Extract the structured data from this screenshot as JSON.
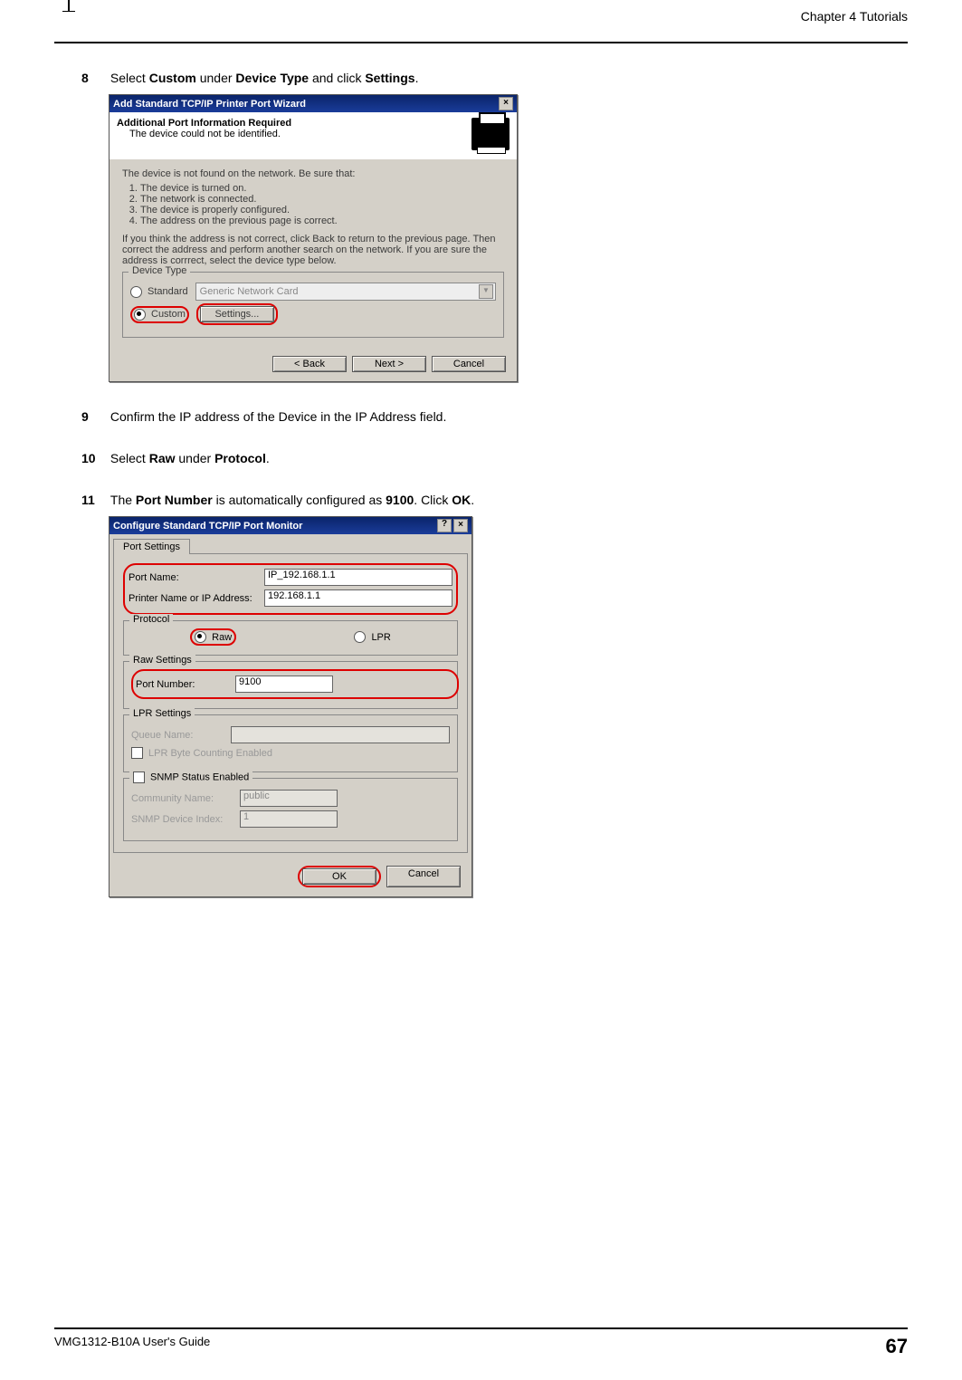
{
  "header": {
    "chapter": "Chapter 4 Tutorials"
  },
  "steps": {
    "s8": {
      "num": "8",
      "t1": "Select ",
      "b1": "Custom",
      "t2": " under ",
      "b2": "Device Type",
      "t3": " and click ",
      "b3": "Settings",
      "t4": "."
    },
    "s9": {
      "num": "9",
      "text": "Confirm the IP address of the Device in the IP Address field."
    },
    "s10": {
      "num": "10",
      "t1": "Select ",
      "b1": "Raw",
      "t2": " under ",
      "b2": "Protocol",
      "t3": "."
    },
    "s11": {
      "num": "11",
      "t1": "The ",
      "b1": "Port Number",
      "t2": " is automatically configured as ",
      "b2": "9100",
      "t3": ". Click ",
      "b3": "OK",
      "t4": "."
    }
  },
  "dlg1": {
    "title": "Add Standard TCP/IP Printer Port Wizard",
    "close": "×",
    "banner_title": "Additional Port Information Required",
    "banner_sub": "The device could not be identified.",
    "body_intro": "The device is not found on the network.  Be sure that:",
    "li1": "The device is turned on.",
    "li2": "The network is connected.",
    "li3": "The device is properly configured.",
    "li4": "The address on the previous page is correct.",
    "body_para": "If you think the address is not correct, click Back to return to the previous page.  Then correct the address and perform another search on the network.  If you are sure the address is corrrect, select the device type below.",
    "legend": "Device Type",
    "radio_standard": "Standard",
    "combo_value": "Generic Network Card",
    "radio_custom": "Custom",
    "settings_btn": "Settings...",
    "back": "< Back",
    "next": "Next >",
    "cancel": "Cancel"
  },
  "dlg2": {
    "title": "Configure Standard TCP/IP Port Monitor",
    "help": "?",
    "close": "×",
    "tab": "Port Settings",
    "port_name_label": "Port Name:",
    "port_name_value": "IP_192.168.1.1",
    "ip_label": "Printer Name or IP Address:",
    "ip_value": "192.168.1.1",
    "protocol_legend": "Protocol",
    "raw": "Raw",
    "lpr": "LPR",
    "raw_legend": "Raw Settings",
    "port_number_label": "Port Number:",
    "port_number_value": "9100",
    "lpr_legend": "LPR Settings",
    "queue_label": "Queue Name:",
    "lpr_byte": "LPR Byte Counting Enabled",
    "snmp_legend": "SNMP Status Enabled",
    "community_label": "Community Name:",
    "community_value": "public",
    "snmp_index_label": "SNMP Device Index:",
    "snmp_index_value": "1",
    "ok": "OK",
    "cancel": "Cancel"
  },
  "footer": {
    "guide": "VMG1312-B10A User's Guide",
    "page": "67"
  }
}
